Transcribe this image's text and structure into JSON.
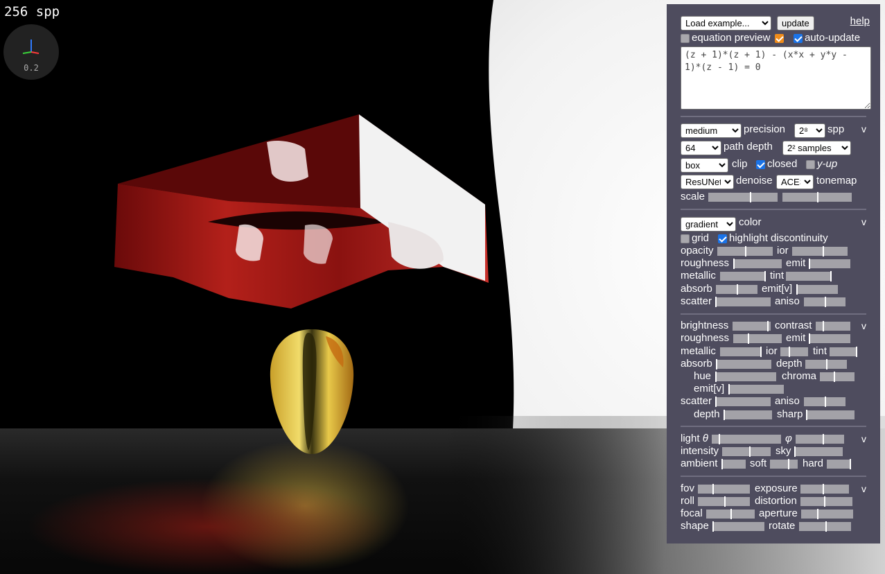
{
  "viewport": {
    "spp_readout": "256 spp",
    "axis_gizmo_scale": "0.2"
  },
  "panel": {
    "help_label": "help",
    "example_select": "Load example...",
    "update_label": "update",
    "equation_preview_label": "equation preview",
    "equation_preview_checked": false,
    "preview_toggle_checked": true,
    "auto_update_label": "auto-update",
    "auto_update_checked": true,
    "equation": "(z + 1)*(z + 1) - (x*x + y*y - 1)*(z - 1) = 0",
    "render": {
      "precision_select": "medium",
      "precision_label": "precision",
      "spp_select": "2⁸",
      "spp_label": "spp",
      "path_depth_select": "64",
      "path_depth_label": "path depth",
      "samples_select": "2² samples",
      "clip_select": "box",
      "clip_label": "clip",
      "closed_label": "closed",
      "closed_checked": true,
      "yup_label": "y-up",
      "yup_checked": false,
      "denoise_select": "ResUNet",
      "denoise_label": "denoise",
      "tonemap_select": "ACES",
      "tonemap_label": "tonemap",
      "scale_label": "scale",
      "caret": "v"
    },
    "material": {
      "color_select": "gradient",
      "color_label": "color",
      "grid_label": "grid",
      "grid_checked": false,
      "highlight_label": "highlight discontinuity",
      "highlight_checked": true,
      "opacity_label": "opacity",
      "ior_label": "ior",
      "roughness_label": "roughness",
      "emit_label": "emit",
      "metallic_label": "metallic",
      "tint_label": "tint",
      "absorb_label": "absorb",
      "emitv_label": "emit[v]",
      "scatter_label": "scatter",
      "aniso_label": "aniso",
      "caret": "v"
    },
    "ground": {
      "brightness_label": "brightness",
      "contrast_label": "contrast",
      "roughness_label": "roughness",
      "emit_label": "emit",
      "metallic_label": "metallic",
      "ior_label": "ior",
      "tint_label": "tint",
      "absorb_label": "absorb",
      "depth_label": "depth",
      "hue_label": "hue",
      "chroma_label": "chroma",
      "emitv_label": "emit[v]",
      "scatter_label": "scatter",
      "aniso_label": "aniso",
      "depth2_label": "depth",
      "sharp_label": "sharp",
      "caret": "v"
    },
    "light": {
      "light_label": "light",
      "theta": "θ",
      "phi": "φ",
      "intensity_label": "intensity",
      "sky_label": "sky",
      "ambient_label": "ambient",
      "soft_label": "soft",
      "hard_label": "hard",
      "caret": "v"
    },
    "camera": {
      "fov_label": "fov",
      "exposure_label": "exposure",
      "roll_label": "roll",
      "distortion_label": "distortion",
      "focal_label": "focal",
      "aperture_label": "aperture",
      "shape_label": "shape",
      "rotate_label": "rotate",
      "caret": "v"
    },
    "slider_levels": {
      "scale_a": 0.6,
      "scale_b": 0.5,
      "opacity": 0.5,
      "ior": 0.55,
      "roughness": 0.0,
      "emit": 0.0,
      "metallic": 0.98,
      "tint": 0.98,
      "absorb": 0.5,
      "emitv": 0.0,
      "scatter": 0.0,
      "aniso": 0.5,
      "brightness": 0.9,
      "contrast": 0.2,
      "g_roughness": 0.3,
      "g_emit": 0.0,
      "g_metallic": 0.98,
      "g_ior": 0.3,
      "g_tint": 0.98,
      "g_absorb": 0.0,
      "g_depth": 0.5,
      "hue": 0.0,
      "chroma": 0.4,
      "g_emitv": 0.0,
      "g_scatter": 0.0,
      "g_aniso": 0.5,
      "g_depth2": 0.0,
      "sharp": 0.0,
      "light_theta": 0.1,
      "light_phi": 0.55,
      "intensity": 0.55,
      "sky": 0.0,
      "ambient": 0.0,
      "soft": 0.65,
      "hard": 0.98,
      "fov": 0.28,
      "exposure": 0.45,
      "roll": 0.5,
      "distortion": 0.45,
      "focal": 0.5,
      "aperture": 0.3,
      "shape": 0.0,
      "rotate": 0.5
    }
  }
}
